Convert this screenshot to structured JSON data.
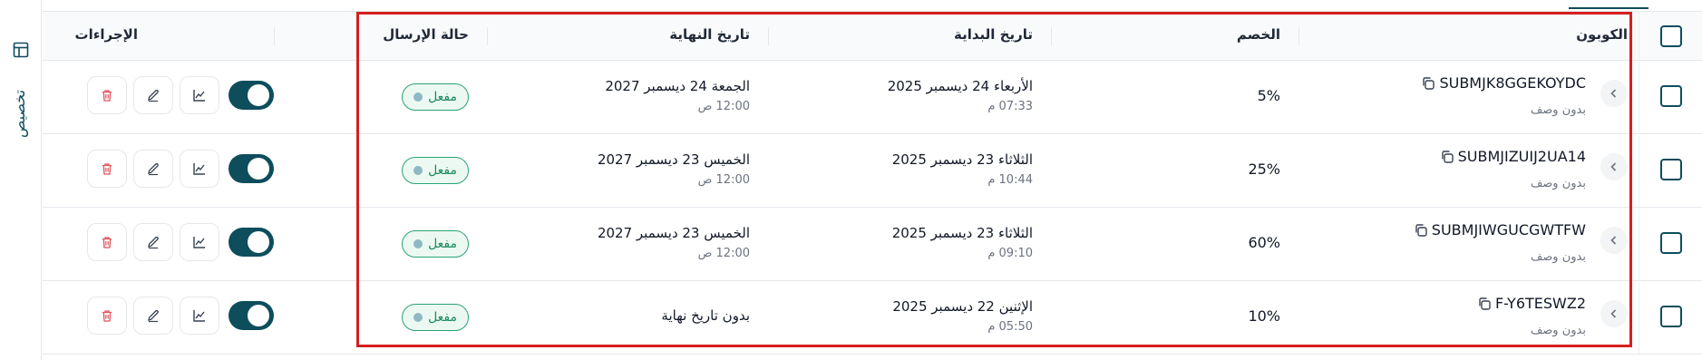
{
  "side_tab": {
    "label": "تخصيص",
    "icon": "table-layout-icon"
  },
  "table": {
    "headers": {
      "coupon": "الكوبون",
      "discount": "الخصم",
      "start_date": "تاريخ البداية",
      "end_date": "تاريخ النهاية",
      "status": "حالة الإرسال",
      "actions": "الإجراءات"
    },
    "rows": [
      {
        "code": "SUBMJK8GGEKOYDC",
        "description": "بدون وصف",
        "discount": "5%",
        "start_date": "الأربعاء 24 ديسمبر 2025",
        "start_time": "07:33 م",
        "end_date": "الجمعة 24 ديسمبر 2027",
        "end_time": "12:00 ص",
        "status": "مفعل",
        "enabled": true
      },
      {
        "code": "SUBMJIZUIJ2UA14",
        "description": "بدون وصف",
        "discount": "25%",
        "start_date": "الثلاثاء 23 ديسمبر 2025",
        "start_time": "10:44 م",
        "end_date": "الخميس 23 ديسمبر 2027",
        "end_time": "12:00 ص",
        "status": "مفعل",
        "enabled": true
      },
      {
        "code": "SUBMJIWGUCGWTFW",
        "description": "بدون وصف",
        "discount": "60%",
        "start_date": "الثلاثاء 23 ديسمبر 2025",
        "start_time": "09:10 م",
        "end_date": "الخميس 23 ديسمبر 2027",
        "end_time": "12:00 ص",
        "status": "مفعل",
        "enabled": true
      },
      {
        "code": "F-Y6TESWZ2",
        "description": "بدون وصف",
        "discount": "10%",
        "start_date": "الإثنين 22 ديسمبر 2025",
        "start_time": "05:50 م",
        "end_date": "بدون تاريخ نهاية",
        "end_time": "",
        "status": "مفعل",
        "enabled": true
      }
    ]
  },
  "colors": {
    "primary": "#0e4d5c",
    "status_green": "#1a8a5e",
    "highlight_red": "#d61f1f",
    "delete_red": "#e0525a"
  }
}
